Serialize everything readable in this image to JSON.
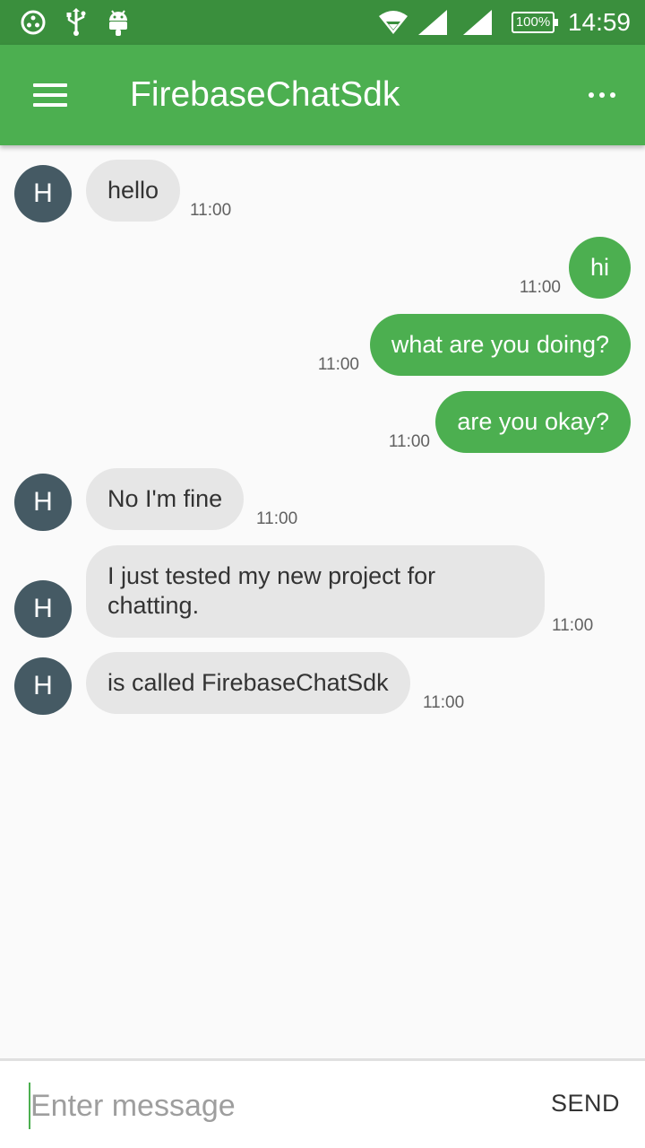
{
  "status_bar": {
    "time": "14:59",
    "battery": "100%",
    "icons": [
      "notification-icon",
      "usb-icon",
      "android-icon",
      "wifi-icon",
      "signal-icon",
      "signal-icon",
      "battery-icon"
    ]
  },
  "app_bar": {
    "title": "FirebaseChatSdk",
    "menu_icon": "hamburger-menu-icon",
    "overflow_icon": "more-vert-icon"
  },
  "messages": [
    {
      "direction": "in",
      "avatar": "H",
      "text": "hello",
      "time": "11:00"
    },
    {
      "direction": "out",
      "text": "hi",
      "time": "11:00"
    },
    {
      "direction": "out",
      "text": "what are you doing?",
      "time": "11:00"
    },
    {
      "direction": "out",
      "text": "are you okay?",
      "time": "11:00"
    },
    {
      "direction": "in",
      "avatar": "H",
      "text": "No I'm fine",
      "time": "11:00"
    },
    {
      "direction": "in",
      "avatar": "H",
      "text": "I just tested my new project for chatting.",
      "time": "11:00"
    },
    {
      "direction": "in",
      "avatar": "H",
      "text": "is called FirebaseChatSdk",
      "time": "11:00"
    }
  ],
  "composer": {
    "placeholder": "Enter message",
    "value": "",
    "send_label": "SEND"
  },
  "colors": {
    "status_bar": "#3a8f3d",
    "app_bar": "#4caf50",
    "outgoing_bubble": "#4caf50",
    "incoming_bubble": "#e6e6e6",
    "avatar": "#455a64"
  }
}
